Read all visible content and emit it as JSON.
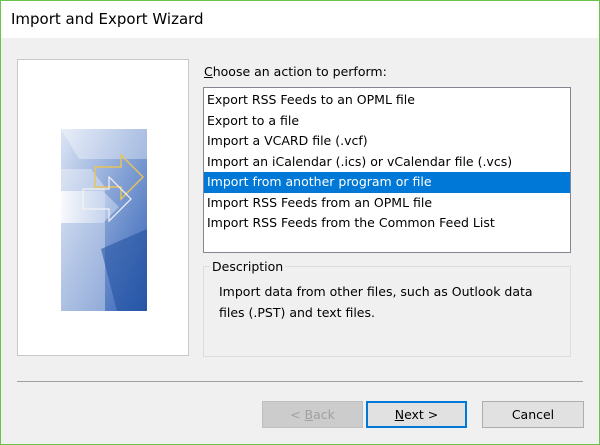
{
  "window": {
    "title": "Import and Export Wizard",
    "border_color": "#6cc24a",
    "background": "#f0f0f0"
  },
  "wizard": {
    "prompt_mnemonic": "C",
    "prompt_rest": "hoose an action to perform:",
    "actions": [
      {
        "label": "Export RSS Feeds to an OPML file",
        "selected": false
      },
      {
        "label": "Export to a file",
        "selected": false
      },
      {
        "label": "Import a VCARD file (.vcf)",
        "selected": false
      },
      {
        "label": "Import an iCalendar (.ics) or vCalendar file (.vcs)",
        "selected": false
      },
      {
        "label": "Import from another program or file",
        "selected": true
      },
      {
        "label": "Import RSS Feeds from an OPML file",
        "selected": false
      },
      {
        "label": "Import RSS Feeds from the Common Feed List",
        "selected": false
      }
    ],
    "selected_color": "#0078d7",
    "description_label": "Description",
    "description_text": "Import data from other files, such as Outlook data files (.PST) and text files."
  },
  "buttons": {
    "back_prefix": "< ",
    "back_mnemonic": "B",
    "back_rest": "ack",
    "back_enabled": false,
    "next_mnemonic": "N",
    "next_rest": "ext >",
    "cancel": "Cancel"
  },
  "icons": {
    "wizard_art": "wizard-graphic-icon"
  }
}
